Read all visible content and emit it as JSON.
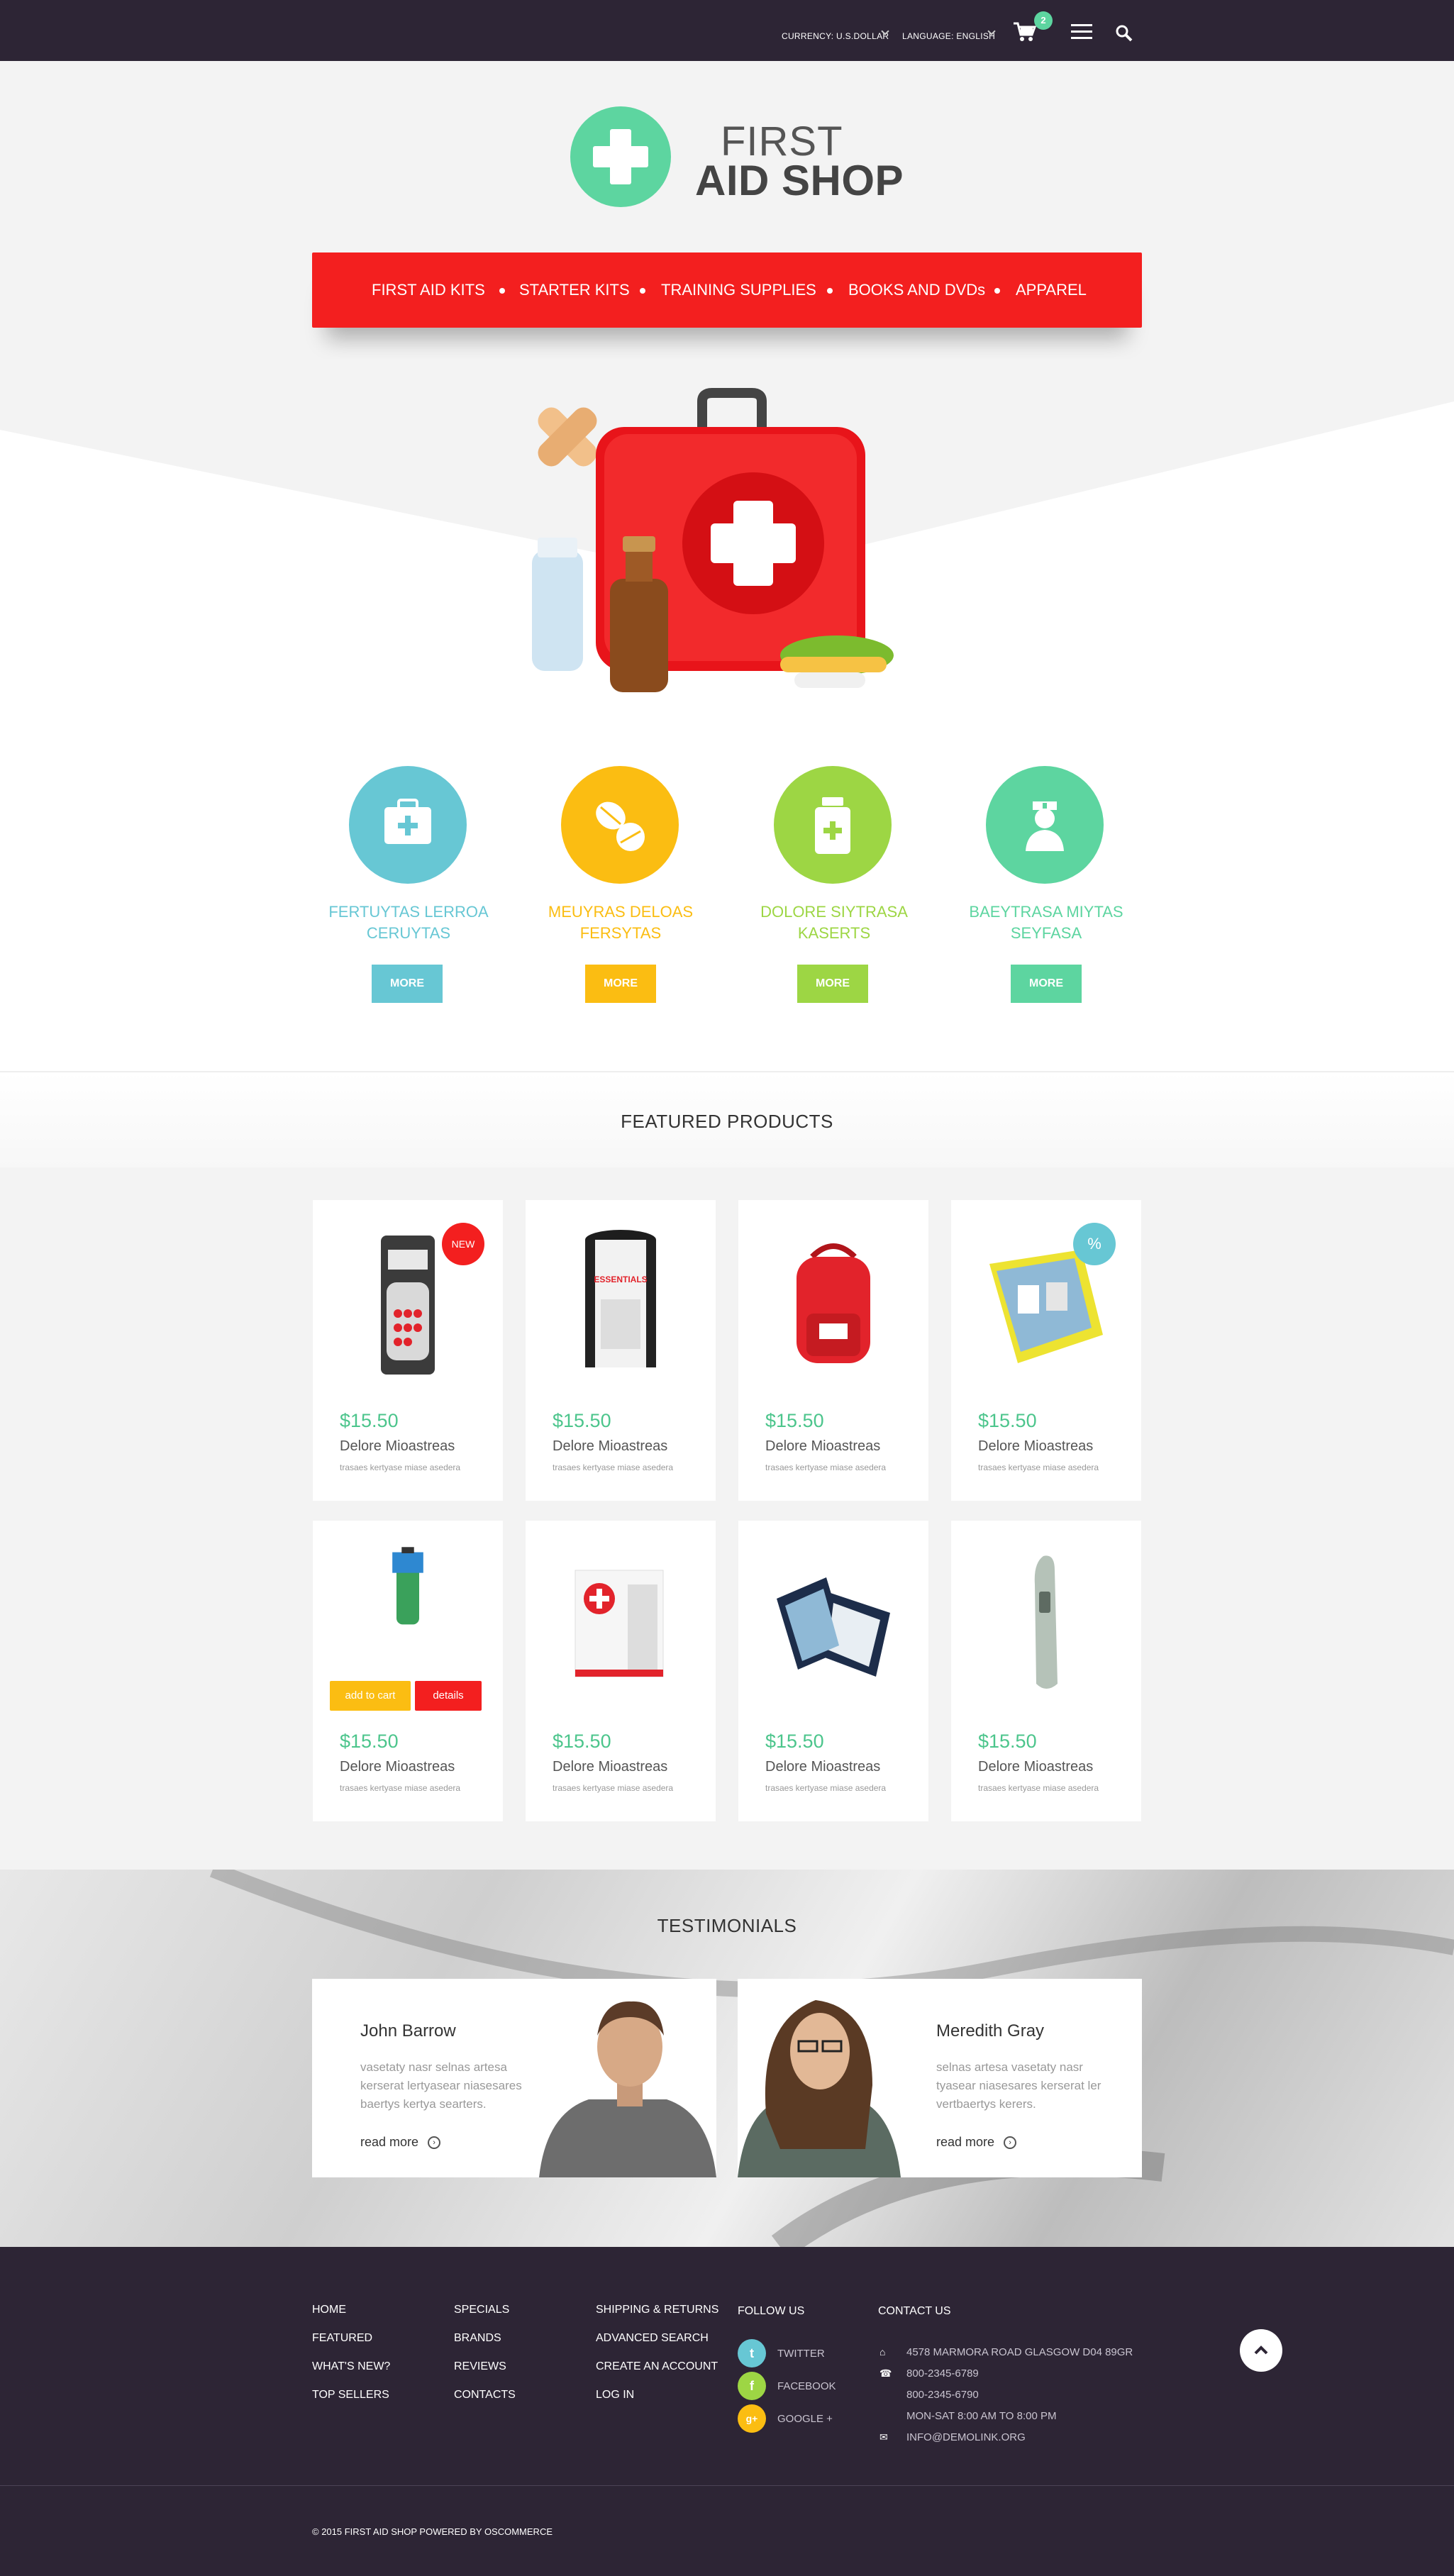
{
  "topbar": {
    "currency_label": "CURRENCY: U.S.DOLLAR",
    "language_label": "LANGUAGE: ENGLISH",
    "cart_count": "2"
  },
  "logo": {
    "line1": "FIRST",
    "line2": "AID SHOP"
  },
  "menu": {
    "items": [
      "FIRST AID KITS",
      "STARTER KITS",
      "TRAINING SUPPLIES",
      "BOOKS AND DVDs",
      "APPAREL"
    ]
  },
  "features": [
    {
      "title": "FERTUYTAS LERROA CERUYTAS",
      "button": "MORE",
      "color": "#67c7d4",
      "icon": "first-aid-kit-icon"
    },
    {
      "title": "MEUYRAS DELOAS FERSYTAS",
      "button": "MORE",
      "color": "#fbbd12",
      "icon": "pills-icon"
    },
    {
      "title": "DOLORE SIYTRASA KASERTS",
      "button": "MORE",
      "color": "#9dd644",
      "icon": "medicine-bottle-icon"
    },
    {
      "title": "BAEYTRASA MIYTAS SEYFASA",
      "button": "MORE",
      "color": "#5dd5a0",
      "icon": "nurse-icon"
    }
  ],
  "featured": {
    "title": "FEATURED PRODUCTS",
    "products": [
      {
        "price": "$15.50",
        "name": "Delore Mioastreas",
        "desc": "trasaes kertyase miase asedera",
        "badge": "NEW"
      },
      {
        "price": "$15.50",
        "name": "Delore Mioastreas",
        "desc": "trasaes kertyase miase asedera",
        "badge": ""
      },
      {
        "price": "$15.50",
        "name": "Delore Mioastreas",
        "desc": "trasaes kertyase miase asedera",
        "badge": ""
      },
      {
        "price": "$15.50",
        "name": "Delore Mioastreas",
        "desc": "trasaes kertyase miase asedera",
        "badge": "%"
      },
      {
        "price": "$15.50",
        "name": "Delore Mioastreas",
        "desc": "trasaes kertyase miase asedera",
        "badge": ""
      },
      {
        "price": "$15.50",
        "name": "Delore Mioastreas",
        "desc": "trasaes kertyase miase asedera",
        "badge": ""
      },
      {
        "price": "$15.50",
        "name": "Delore Mioastreas",
        "desc": "trasaes kertyase miase asedera",
        "badge": ""
      },
      {
        "price": "$15.50",
        "name": "Delore Mioastreas",
        "desc": "trasaes kertyase miase asedera",
        "badge": ""
      }
    ],
    "add_to_cart": "add to cart",
    "details": "details"
  },
  "testimonials": {
    "title": "TESTIMONIALS",
    "items": [
      {
        "name": "John Barrow",
        "text": "vasetaty nasr selnas artesa kerserat lertyasear niasesares baertys kertya searters.",
        "more": "read more"
      },
      {
        "name": "Meredith Gray",
        "text": "selnas artesa vasetaty nasr tyasear niasesares kerserat ler vertbaertys kerers.",
        "more": "read more"
      }
    ]
  },
  "footer": {
    "col1": [
      "HOME",
      "FEATURED",
      "WHAT'S NEW?",
      "TOP SELLERS"
    ],
    "col2": [
      "SPECIALS",
      "BRANDS",
      "REVIEWS",
      "CONTACTS"
    ],
    "col3": [
      "SHIPPING & RETURNS",
      "ADVANCED SEARCH",
      "CREATE AN ACCOUNT",
      "LOG IN"
    ],
    "follow_title": "FOLLOW US",
    "social": [
      {
        "label": "TWITTER",
        "glyph": "t",
        "color": "#67c7d4"
      },
      {
        "label": "FACEBOOK",
        "glyph": "f",
        "color": "#9dd644"
      },
      {
        "label": "GOOGLE +",
        "glyph": "g+",
        "color": "#fbbd12"
      }
    ],
    "contact_title": "CONTACT US",
    "address": "4578 MARMORA ROAD GLASGOW D04 89GR",
    "phone1": "800-2345-6789",
    "phone2": "800-2345-6790",
    "hours": "MON-SAT 8:00 AM TO 8:00 PM",
    "email": "INFO@DEMOLINK.ORG",
    "copyright": "© 2015 FIRST AID SHOP POWERED BY OSCOMMERCE"
  }
}
